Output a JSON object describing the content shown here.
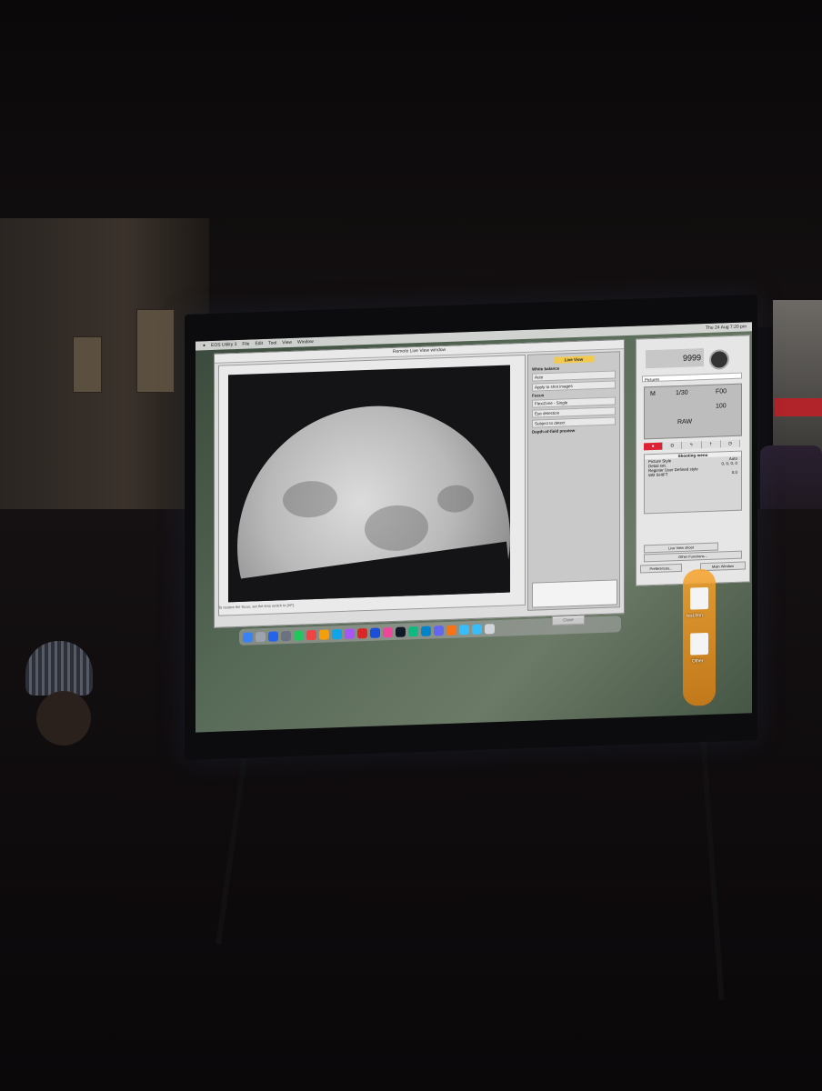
{
  "menubar": {
    "app_name": "EOS Utility 3",
    "menus": [
      "File",
      "Edit",
      "Tool",
      "View",
      "Window"
    ],
    "clock": "Thu 24 Aug  7:20 pm"
  },
  "live_window": {
    "title": "Remote Live View window",
    "hint": "To restore the focus, set the lens switch to [AF]."
  },
  "side_panel": {
    "live_view_button": "Live View",
    "white_balance_label": "White balance",
    "white_balance_value": "Auto",
    "apply_shot_images": "Apply to shot images",
    "focus_label": "Focus",
    "focus_mode": "FlexiZone - Single",
    "eye_detection": "Eye detection",
    "subject_to_detect": "Subject to detect",
    "depth_of_field": "Depth-of-field preview",
    "close_button": "Close"
  },
  "camera_panel": {
    "shots_remaining": "9999",
    "destination_folder": "Pictures",
    "mode": "M",
    "shutter": "1/30",
    "aperture": "F00",
    "iso": "100",
    "quality": "RAW",
    "shooting_menu_title": "Shooting menu",
    "menu_items": [
      {
        "label": "Picture Style",
        "value": "Auto"
      },
      {
        "label": "Detail set.",
        "value": "0, 0, 0, 0"
      },
      {
        "label": "Register User Defined style",
        "value": ""
      },
      {
        "label": "WB SHIFT",
        "value": "0,0"
      }
    ],
    "live_view_shoot": "Live View shoot",
    "other_functions": "Other Functions...",
    "preferences": "Preferences...",
    "main_window": "Main Window"
  },
  "desktop": {
    "files": [
      "test.htm",
      "Other"
    ]
  },
  "colors": {
    "accent_yellow": "#f2c94c",
    "shooting_tab_red": "#d22233",
    "desktop_orange": "#f7a32b"
  }
}
